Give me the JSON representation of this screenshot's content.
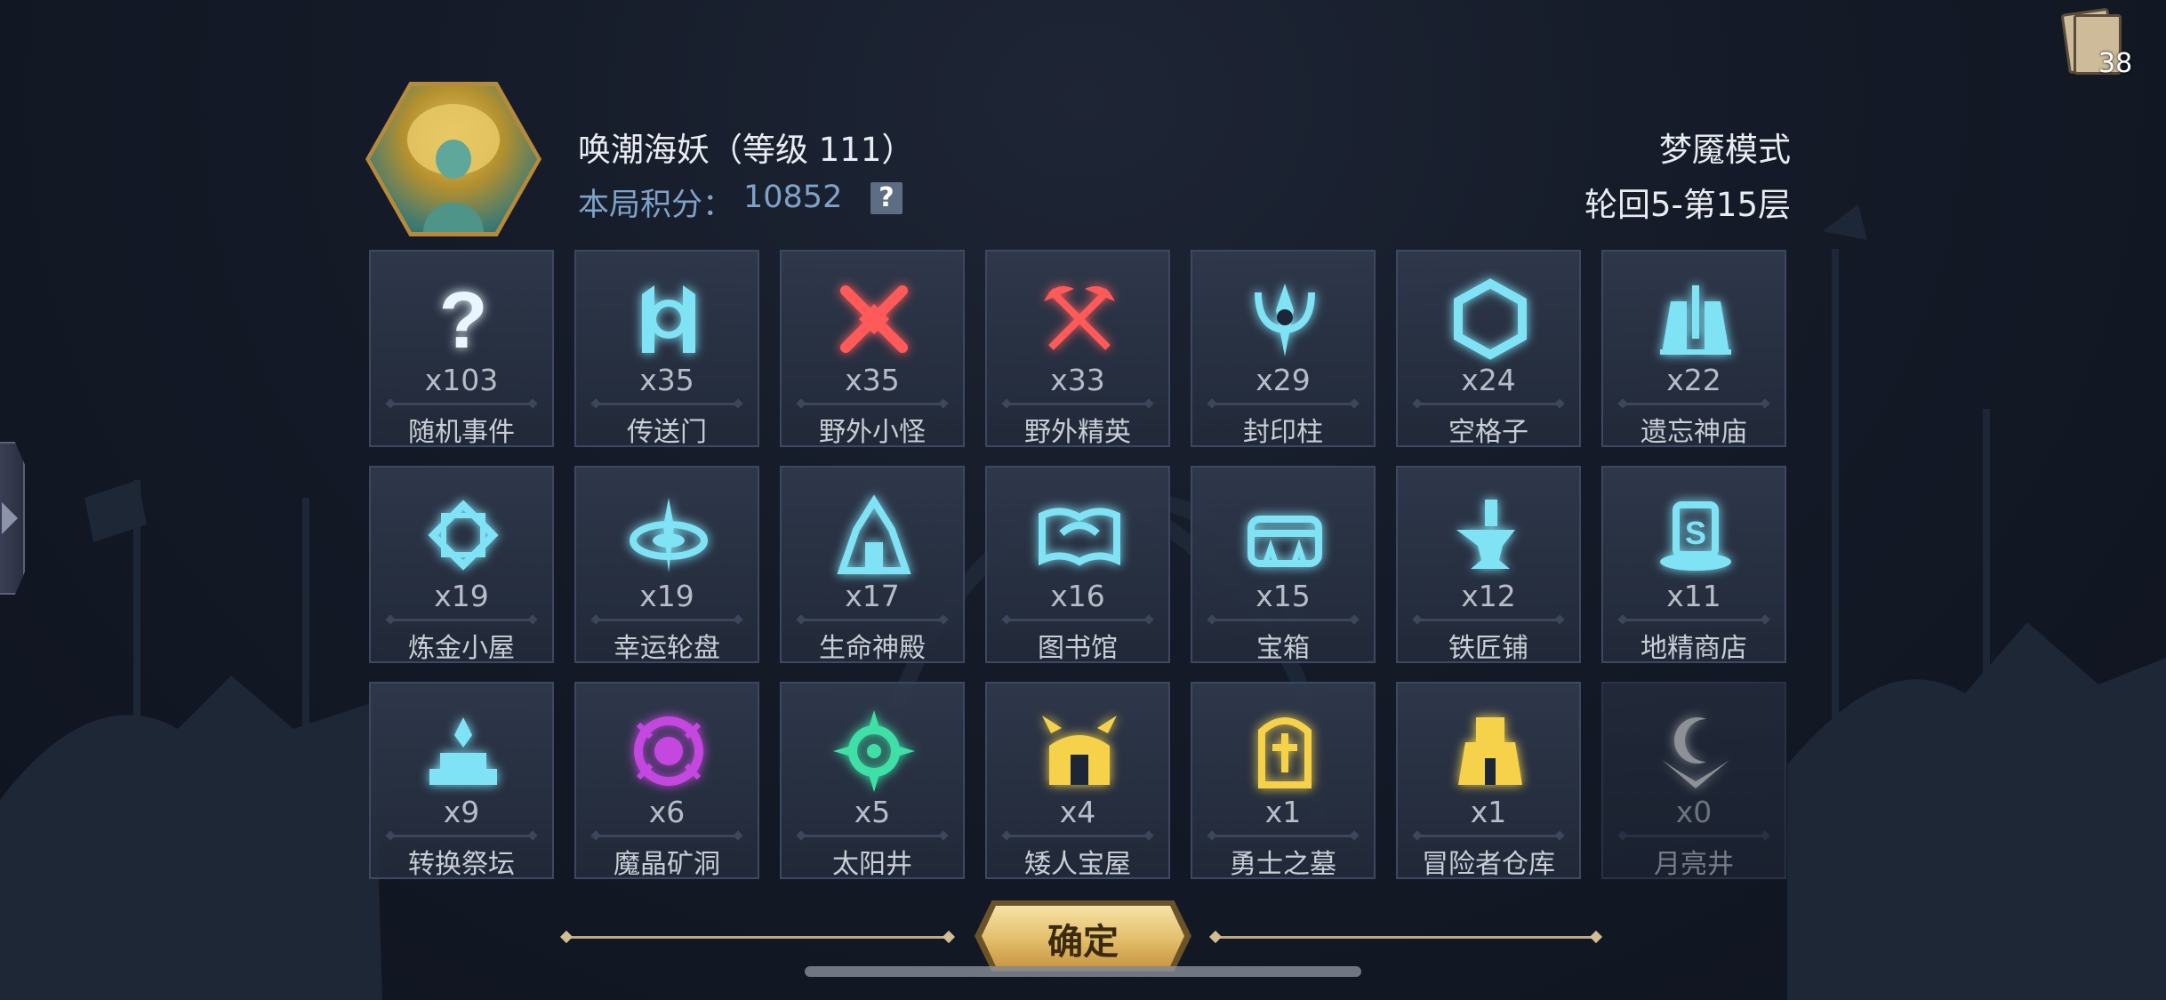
{
  "header": {
    "hero_name": "唤潮海妖（等级 111）",
    "score_label": "本局积分：",
    "score_value": "10852",
    "help_icon": "?",
    "mode": "梦魇模式",
    "floor": "轮回5-第15层"
  },
  "deck": {
    "count": "38",
    "icon": "card-deck-icon"
  },
  "tiles": [
    {
      "count": "x103",
      "label": "随机事件",
      "icon": "question-mark-icon",
      "color": "#e9f6ff"
    },
    {
      "count": "x35",
      "label": "传送门",
      "icon": "portal-icon",
      "color": "#7fe3f5"
    },
    {
      "count": "x35",
      "label": "野外小怪",
      "icon": "crossed-swords-icon",
      "color": "#ff5a5a"
    },
    {
      "count": "x33",
      "label": "野外精英",
      "icon": "crossed-axes-icon",
      "color": "#ff5a5a"
    },
    {
      "count": "x29",
      "label": "封印柱",
      "icon": "seal-pillar-icon",
      "color": "#7fe3f5"
    },
    {
      "count": "x24",
      "label": "空格子",
      "icon": "hexagon-icon",
      "color": "#7fe3f5"
    },
    {
      "count": "x22",
      "label": "遗忘神庙",
      "icon": "temple-icon",
      "color": "#7fe3f5"
    },
    {
      "count": "x19",
      "label": "炼金小屋",
      "icon": "alchemy-icon",
      "color": "#7fe3f5"
    },
    {
      "count": "x19",
      "label": "幸运轮盘",
      "icon": "wheel-icon",
      "color": "#7fe3f5"
    },
    {
      "count": "x17",
      "label": "生命神殿",
      "icon": "life-shrine-icon",
      "color": "#7fe3f5"
    },
    {
      "count": "x16",
      "label": "图书馆",
      "icon": "book-icon",
      "color": "#7fe3f5"
    },
    {
      "count": "x15",
      "label": "宝箱",
      "icon": "chest-icon",
      "color": "#7fe3f5"
    },
    {
      "count": "x12",
      "label": "铁匠铺",
      "icon": "anvil-icon",
      "color": "#7fe3f5"
    },
    {
      "count": "x11",
      "label": "地精商店",
      "icon": "goblin-shop-icon",
      "color": "#7fe3f5"
    },
    {
      "count": "x9",
      "label": "转换祭坛",
      "icon": "altar-icon",
      "color": "#7fe3f5"
    },
    {
      "count": "x6",
      "label": "魔晶矿洞",
      "icon": "crystal-mine-icon",
      "color": "#c447e0"
    },
    {
      "count": "x5",
      "label": "太阳井",
      "icon": "sun-well-icon",
      "color": "#3fe0a5"
    },
    {
      "count": "x4",
      "label": "矮人宝屋",
      "icon": "dwarf-vault-icon",
      "color": "#f5d24a"
    },
    {
      "count": "x1",
      "label": "勇士之墓",
      "icon": "tomb-icon",
      "color": "#f5d24a"
    },
    {
      "count": "x1",
      "label": "冒险者仓库",
      "icon": "warehouse-icon",
      "color": "#f5d24a"
    },
    {
      "count": "x0",
      "label": "月亮井",
      "icon": "moon-well-icon",
      "color": "#f2f2f2"
    }
  ],
  "confirm": {
    "label": "确定"
  }
}
